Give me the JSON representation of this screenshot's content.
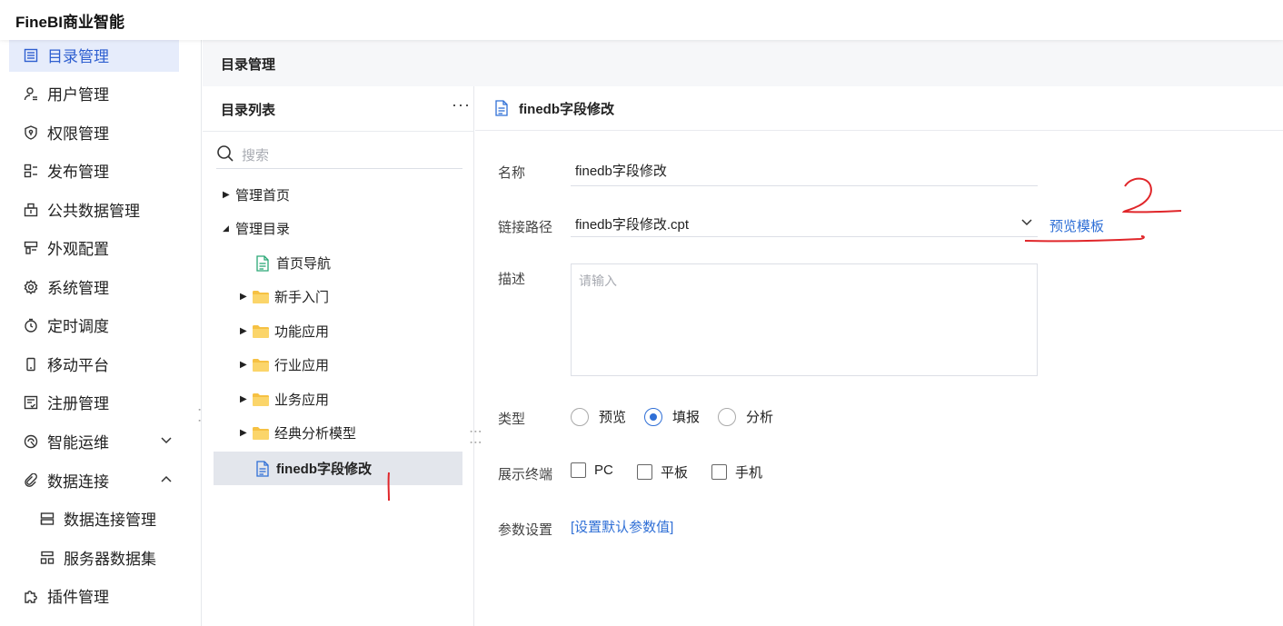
{
  "app": {
    "title": "FineBI商业智能"
  },
  "sidebar": {
    "items": [
      {
        "label": "目录管理",
        "icon": "list-icon",
        "active": true
      },
      {
        "label": "用户管理",
        "icon": "user-icon"
      },
      {
        "label": "权限管理",
        "icon": "shield-icon"
      },
      {
        "label": "发布管理",
        "icon": "publish-icon"
      },
      {
        "label": "公共数据管理",
        "icon": "database-icon"
      },
      {
        "label": "外观配置",
        "icon": "appearance-icon"
      },
      {
        "label": "系统管理",
        "icon": "gear-icon"
      },
      {
        "label": "定时调度",
        "icon": "timer-icon"
      },
      {
        "label": "移动平台",
        "icon": "mobile-icon"
      },
      {
        "label": "注册管理",
        "icon": "register-icon"
      },
      {
        "label": "智能运维",
        "icon": "ops-icon",
        "expand": "down"
      },
      {
        "label": "数据连接",
        "icon": "link-icon",
        "expand": "up"
      },
      {
        "label": "数据连接管理",
        "icon": "server-icon",
        "sub": true
      },
      {
        "label": "服务器数据集",
        "icon": "dataset-icon",
        "sub": true
      },
      {
        "label": "插件管理",
        "icon": "plugin-icon"
      }
    ]
  },
  "content": {
    "header_title": "目录管理"
  },
  "tree": {
    "title": "目录列表",
    "more": "···",
    "search_placeholder": "搜索",
    "nodes": [
      {
        "label": "管理首页",
        "type": "collapsed"
      },
      {
        "label": "管理目录",
        "type": "expanded"
      },
      {
        "label": "首页导航",
        "type": "page"
      },
      {
        "label": "新手入门",
        "type": "folder"
      },
      {
        "label": "功能应用",
        "type": "folder"
      },
      {
        "label": "行业应用",
        "type": "folder"
      },
      {
        "label": "业务应用",
        "type": "folder"
      },
      {
        "label": "经典分析模型",
        "type": "folder"
      },
      {
        "label": "finedb字段修改",
        "type": "doc",
        "selected": true
      }
    ]
  },
  "detail": {
    "title": "finedb字段修改",
    "name_label": "名称",
    "name_value": "finedb字段修改",
    "path_label": "链接路径",
    "path_value": "finedb字段修改.cpt",
    "preview_link": "预览模板",
    "desc_label": "描述",
    "desc_placeholder": "请输入",
    "type_label": "类型",
    "type_options": [
      "预览",
      "填报",
      "分析"
    ],
    "type_selected": "填报",
    "terminal_label": "展示终端",
    "terminal_options": [
      "PC",
      "平板",
      "手机"
    ],
    "param_label": "参数设置",
    "param_link": "[设置默认参数值]"
  },
  "colors": {
    "accent": "#2f6fd6",
    "annotation": "#e0262a",
    "active_bg": "#e6ecfb"
  }
}
